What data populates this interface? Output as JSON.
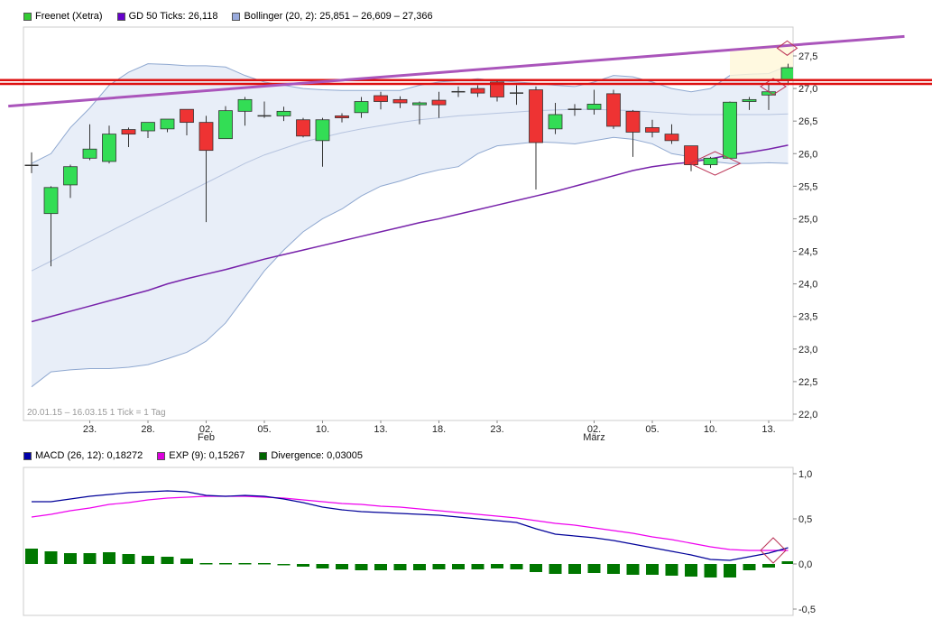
{
  "legend_top": [
    {
      "label": "Freenet (Xetra)",
      "color": "#33cc33"
    },
    {
      "label": "GD 50 Ticks: 26,118",
      "color": "#6600cc"
    },
    {
      "label": "Bollinger (20, 2): 25,851 – 26,609 – 27,366",
      "color": "#99aadd"
    }
  ],
  "legend_bottom": [
    {
      "label": "MACD (26, 12): 0,18272",
      "color": "#0000aa"
    },
    {
      "label": "EXP (9): 0,15267",
      "color": "#dd00dd"
    },
    {
      "label": "Divergence: 0,03005",
      "color": "#006600"
    }
  ],
  "info_text": "20.01.15 – 16.03.15   1 Tick = 1 Tag",
  "colors": {
    "up": "#33dd55",
    "down": "#ee3333",
    "ma": "#7722aa",
    "band_fill": "#e8eef8",
    "band_line": "#8fa8d0",
    "macd": "#000099",
    "exp": "#ee00ee",
    "divergence": "#007700",
    "trend": "#aa55bb",
    "resistance": "#dd1111"
  },
  "chart_data": [
    {
      "type": "candlestick",
      "title": "Freenet (Xetra)",
      "ylim": [
        22.0,
        27.8
      ],
      "y_ticks": [
        "22,0",
        "22,5",
        "23,0",
        "23,5",
        "24,0",
        "24,5",
        "25,0",
        "25,5",
        "26,0",
        "26,5",
        "27,0",
        "27,5"
      ],
      "x_ticks": [
        {
          "index": 3,
          "label": "23."
        },
        {
          "index": 6,
          "label": "28."
        },
        {
          "index": 9,
          "label": "02.",
          "sub": "Feb"
        },
        {
          "index": 12,
          "label": "05."
        },
        {
          "index": 15,
          "label": "10."
        },
        {
          "index": 18,
          "label": "13."
        },
        {
          "index": 21,
          "label": "18."
        },
        {
          "index": 24,
          "label": "23."
        },
        {
          "index": 29,
          "label": "02.",
          "sub": "März"
        },
        {
          "index": 32,
          "label": "05."
        },
        {
          "index": 35,
          "label": "10."
        },
        {
          "index": 38,
          "label": "13."
        }
      ],
      "candles": [
        {
          "o": 25.82,
          "h": 26.02,
          "l": 25.7,
          "c": 25.82
        },
        {
          "o": 25.08,
          "h": 25.5,
          "l": 24.27,
          "c": 25.48
        },
        {
          "o": 25.52,
          "h": 25.83,
          "l": 25.32,
          "c": 25.8
        },
        {
          "o": 25.93,
          "h": 26.45,
          "l": 25.9,
          "c": 26.07
        },
        {
          "o": 25.88,
          "h": 26.43,
          "l": 25.85,
          "c": 26.3
        },
        {
          "o": 26.37,
          "h": 26.4,
          "l": 26.1,
          "c": 26.3
        },
        {
          "o": 26.35,
          "h": 26.45,
          "l": 26.24,
          "c": 26.48
        },
        {
          "o": 26.38,
          "h": 26.52,
          "l": 26.33,
          "c": 26.53
        },
        {
          "o": 26.68,
          "h": 26.68,
          "l": 26.28,
          "c": 26.48
        },
        {
          "o": 26.48,
          "h": 26.58,
          "l": 24.95,
          "c": 26.05
        },
        {
          "o": 26.23,
          "h": 26.73,
          "l": 26.23,
          "c": 26.66
        },
        {
          "o": 26.65,
          "h": 26.87,
          "l": 26.43,
          "c": 26.83
        },
        {
          "o": 26.58,
          "h": 26.8,
          "l": 26.55,
          "c": 26.58
        },
        {
          "o": 26.58,
          "h": 26.72,
          "l": 26.5,
          "c": 26.65
        },
        {
          "o": 26.52,
          "h": 26.55,
          "l": 26.25,
          "c": 26.27
        },
        {
          "o": 26.2,
          "h": 26.55,
          "l": 25.8,
          "c": 26.52
        },
        {
          "o": 26.58,
          "h": 26.62,
          "l": 26.48,
          "c": 26.55
        },
        {
          "o": 26.63,
          "h": 26.87,
          "l": 26.55,
          "c": 26.8
        },
        {
          "o": 26.89,
          "h": 26.95,
          "l": 26.68,
          "c": 26.8
        },
        {
          "o": 26.83,
          "h": 26.88,
          "l": 26.7,
          "c": 26.78
        },
        {
          "o": 26.75,
          "h": 26.8,
          "l": 26.45,
          "c": 26.78
        },
        {
          "o": 26.82,
          "h": 26.95,
          "l": 26.55,
          "c": 26.75
        },
        {
          "o": 26.93,
          "h": 27.03,
          "l": 26.87,
          "c": 26.95
        },
        {
          "o": 27.0,
          "h": 27.05,
          "l": 26.87,
          "c": 26.93
        },
        {
          "o": 27.1,
          "h": 27.12,
          "l": 26.8,
          "c": 26.87
        },
        {
          "o": 26.92,
          "h": 27.05,
          "l": 26.75,
          "c": 26.93
        },
        {
          "o": 26.98,
          "h": 27.03,
          "l": 25.45,
          "c": 26.17
        },
        {
          "o": 26.38,
          "h": 26.78,
          "l": 26.3,
          "c": 26.6
        },
        {
          "o": 26.68,
          "h": 26.76,
          "l": 26.58,
          "c": 26.68
        },
        {
          "o": 26.68,
          "h": 26.98,
          "l": 26.6,
          "c": 26.76
        },
        {
          "o": 26.92,
          "h": 26.98,
          "l": 26.38,
          "c": 26.42
        },
        {
          "o": 26.65,
          "h": 26.67,
          "l": 25.95,
          "c": 26.33
        },
        {
          "o": 26.4,
          "h": 26.52,
          "l": 26.25,
          "c": 26.33
        },
        {
          "o": 26.3,
          "h": 26.45,
          "l": 26.15,
          "c": 26.2
        },
        {
          "o": 26.12,
          "h": 26.12,
          "l": 25.73,
          "c": 25.83
        },
        {
          "o": 25.83,
          "h": 25.95,
          "l": 25.78,
          "c": 25.93
        },
        {
          "o": 25.93,
          "h": 26.8,
          "l": 25.92,
          "c": 26.79
        },
        {
          "o": 26.8,
          "h": 26.87,
          "l": 26.67,
          "c": 26.83
        },
        {
          "o": 26.9,
          "h": 27.08,
          "l": 26.67,
          "c": 26.95
        },
        {
          "o": 27.12,
          "h": 27.38,
          "l": 27.05,
          "c": 27.32
        }
      ],
      "ma50": [
        23.42,
        23.5,
        23.58,
        23.66,
        23.74,
        23.82,
        23.9,
        24.0,
        24.08,
        24.15,
        24.22,
        24.3,
        24.38,
        24.45,
        24.52,
        24.59,
        24.66,
        24.73,
        24.8,
        24.87,
        24.94,
        25.0,
        25.07,
        25.14,
        25.21,
        25.28,
        25.35,
        25.42,
        25.5,
        25.58,
        25.66,
        25.74,
        25.8,
        25.84,
        25.87,
        25.92,
        25.98,
        26.02,
        26.07,
        26.13
      ],
      "bollinger_upper": [
        25.85,
        26.0,
        26.4,
        26.7,
        27.05,
        27.25,
        27.38,
        27.37,
        27.35,
        27.35,
        27.33,
        27.2,
        27.1,
        27.05,
        27.0,
        26.98,
        26.97,
        26.97,
        26.97,
        26.97,
        27.05,
        27.1,
        27.12,
        27.15,
        27.12,
        27.1,
        27.08,
        27.05,
        27.03,
        27.1,
        27.2,
        27.18,
        27.1,
        27.0,
        26.95,
        27.0,
        27.2,
        27.22,
        27.23,
        27.35
      ],
      "bollinger_mid": [
        24.2,
        24.35,
        24.5,
        24.65,
        24.8,
        24.95,
        25.1,
        25.25,
        25.4,
        25.55,
        25.7,
        25.85,
        25.98,
        26.08,
        26.18,
        26.25,
        26.32,
        26.38,
        26.43,
        26.48,
        26.52,
        26.55,
        26.58,
        26.6,
        26.62,
        26.64,
        26.66,
        26.67,
        26.68,
        26.68,
        26.67,
        26.66,
        26.64,
        26.62,
        26.6,
        26.6,
        26.6,
        26.6,
        26.6,
        26.61
      ],
      "bollinger_lower": [
        22.42,
        22.65,
        22.68,
        22.7,
        22.7,
        22.72,
        22.76,
        22.85,
        22.95,
        23.12,
        23.4,
        23.8,
        24.2,
        24.52,
        24.8,
        25.0,
        25.15,
        25.35,
        25.5,
        25.58,
        25.68,
        25.75,
        25.8,
        26.0,
        26.12,
        26.15,
        26.18,
        26.17,
        26.15,
        26.2,
        26.25,
        26.22,
        26.15,
        26.0,
        25.95,
        25.88,
        25.85,
        25.85,
        25.86,
        25.85
      ],
      "trend_line": {
        "x": [
          -1.2,
          45
        ],
        "y": [
          26.73,
          27.8
        ]
      },
      "resistance_lines": [
        27.07,
        27.13
      ]
    },
    {
      "type": "macd",
      "ylim": [
        -0.5,
        1.0
      ],
      "y_ticks": [
        "1,0",
        "0,5",
        "0,0",
        "-0,5"
      ],
      "macd": [
        0.69,
        0.69,
        0.72,
        0.75,
        0.77,
        0.79,
        0.8,
        0.81,
        0.8,
        0.76,
        0.75,
        0.76,
        0.75,
        0.72,
        0.68,
        0.63,
        0.6,
        0.58,
        0.57,
        0.56,
        0.55,
        0.54,
        0.52,
        0.5,
        0.48,
        0.46,
        0.39,
        0.33,
        0.31,
        0.29,
        0.26,
        0.22,
        0.18,
        0.14,
        0.1,
        0.05,
        0.04,
        0.08,
        0.12,
        0.18
      ],
      "exp": [
        0.52,
        0.55,
        0.59,
        0.62,
        0.66,
        0.68,
        0.71,
        0.73,
        0.74,
        0.75,
        0.75,
        0.75,
        0.74,
        0.73,
        0.71,
        0.69,
        0.67,
        0.66,
        0.64,
        0.63,
        0.61,
        0.59,
        0.57,
        0.55,
        0.53,
        0.51,
        0.48,
        0.45,
        0.43,
        0.4,
        0.37,
        0.34,
        0.3,
        0.27,
        0.23,
        0.19,
        0.16,
        0.15,
        0.15,
        0.15
      ],
      "divergence": [
        0.17,
        0.14,
        0.12,
        0.12,
        0.13,
        0.11,
        0.09,
        0.08,
        0.06,
        0.01,
        0.01,
        0.01,
        0.01,
        -0.01,
        -0.03,
        -0.05,
        -0.06,
        -0.07,
        -0.07,
        -0.07,
        -0.07,
        -0.06,
        -0.06,
        -0.06,
        -0.05,
        -0.06,
        -0.09,
        -0.11,
        -0.11,
        -0.1,
        -0.11,
        -0.12,
        -0.12,
        -0.13,
        -0.14,
        -0.15,
        -0.15,
        -0.07,
        -0.04,
        0.03
      ]
    }
  ]
}
